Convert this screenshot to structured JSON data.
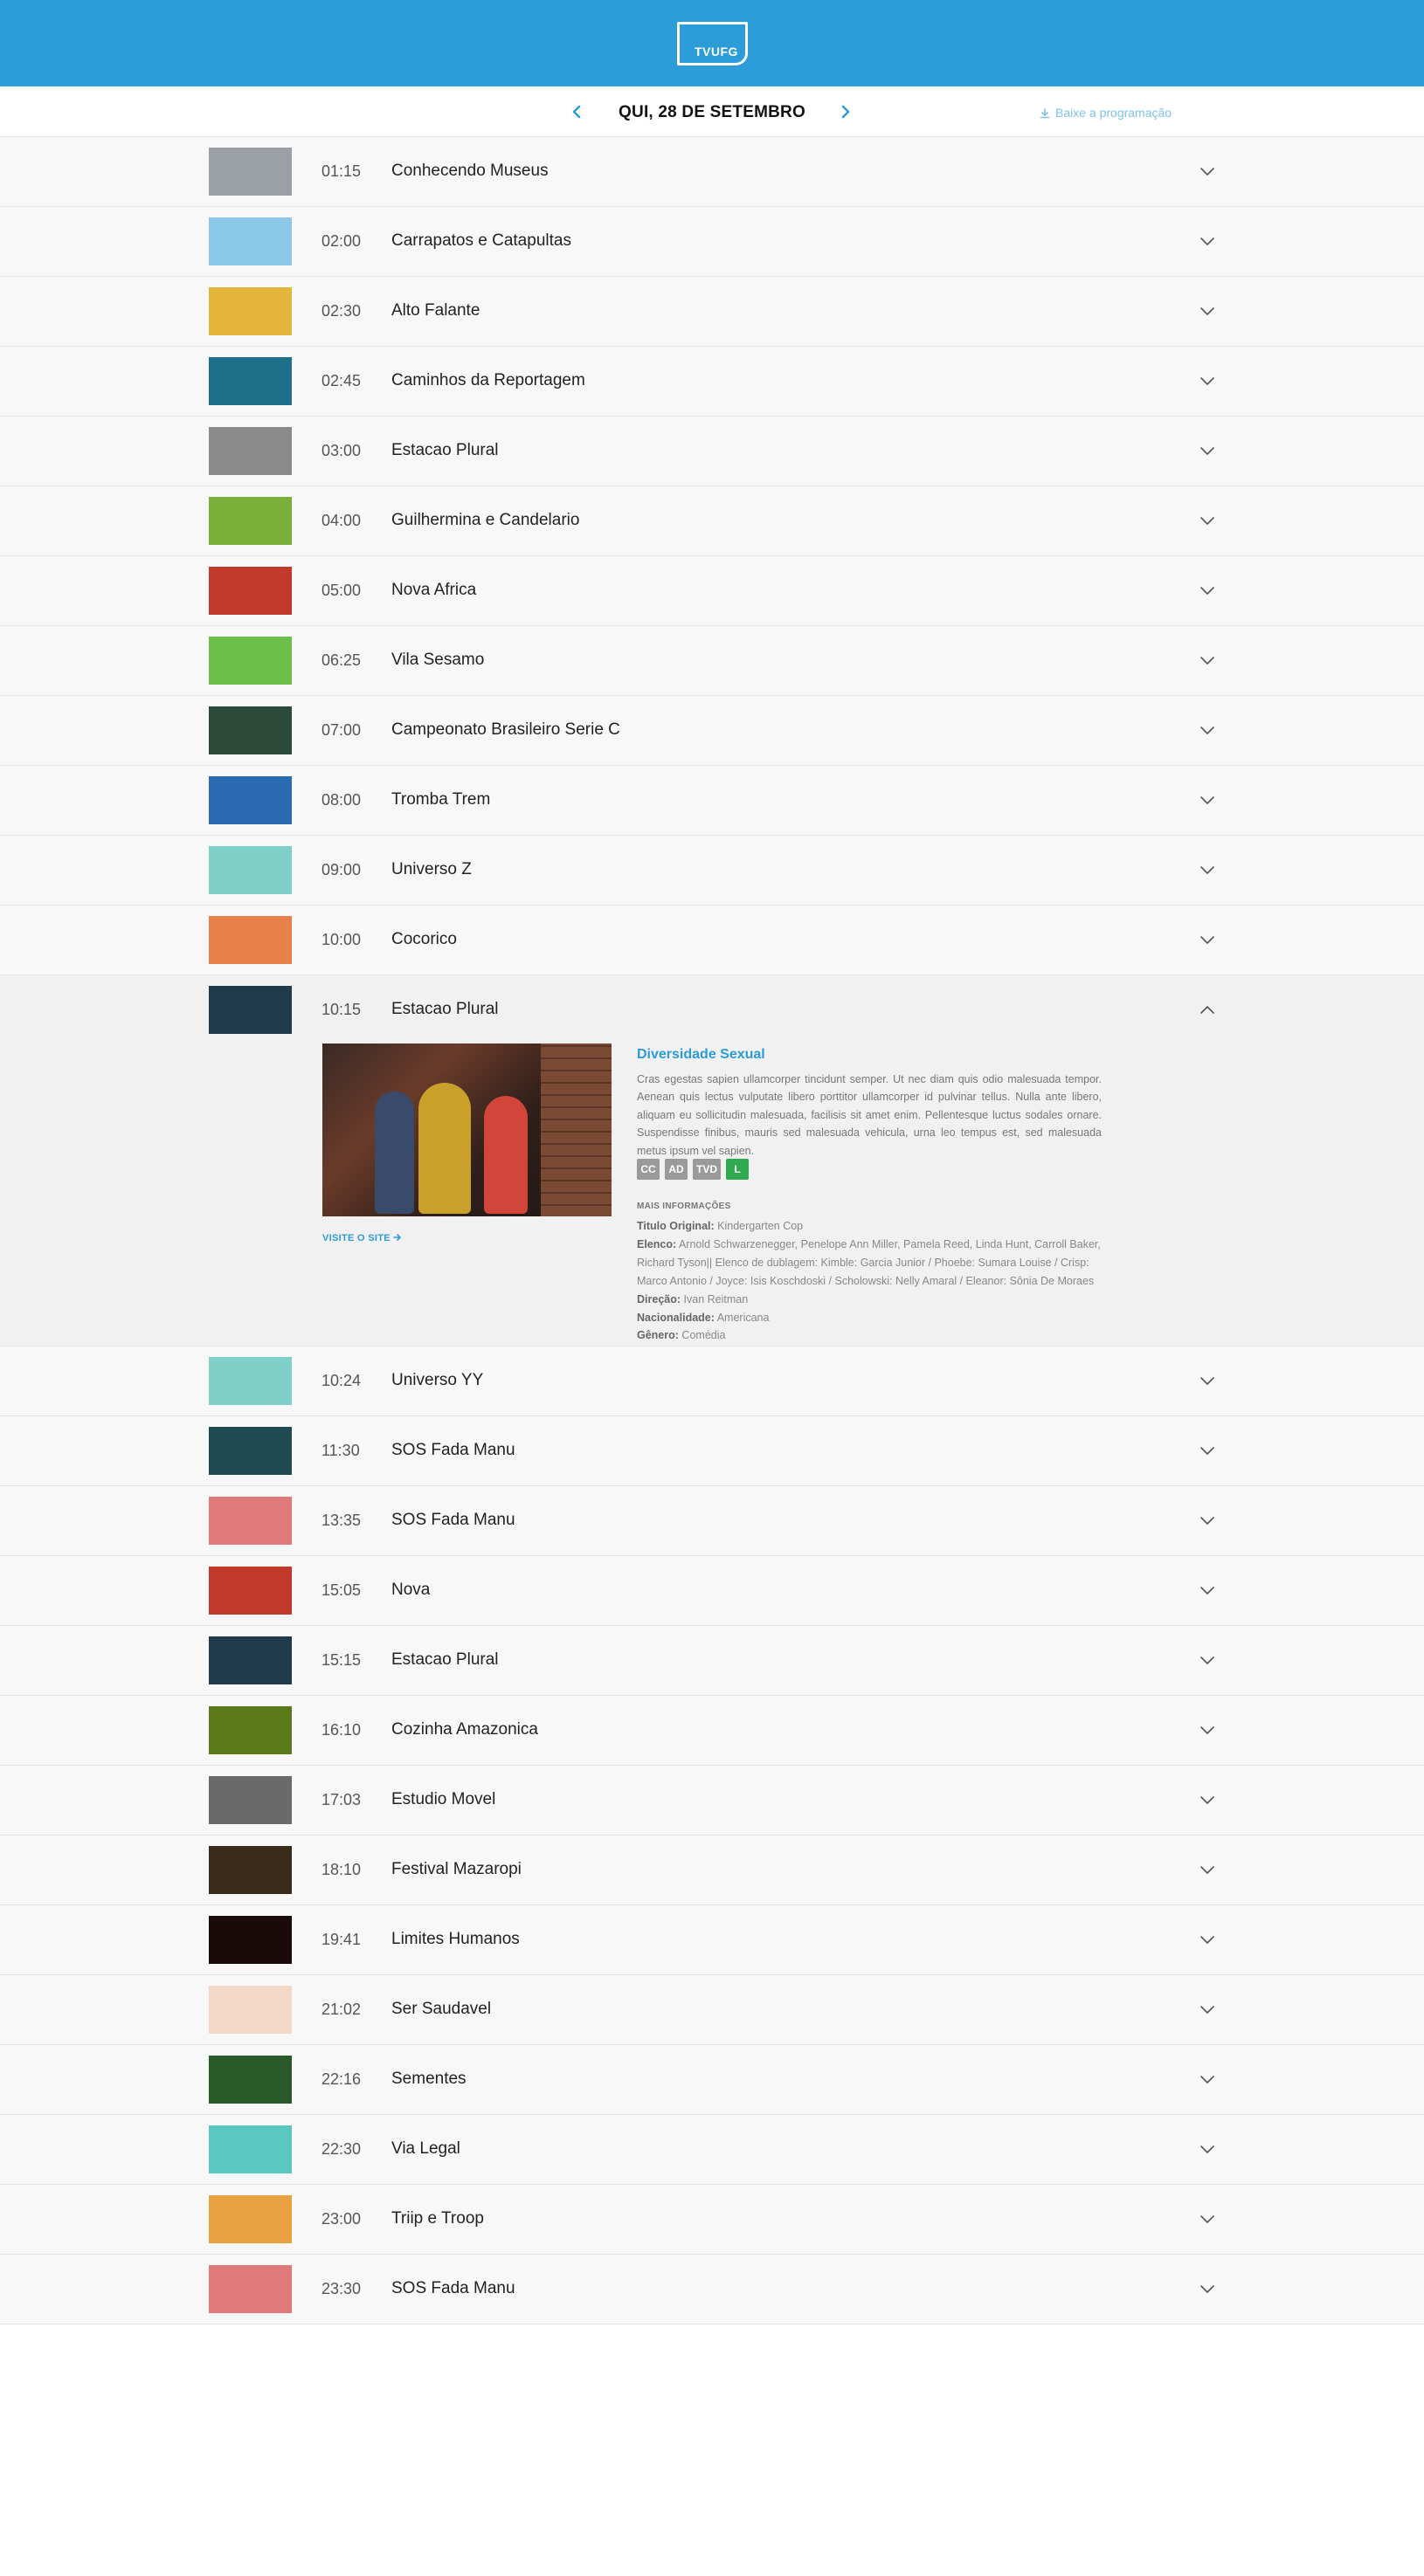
{
  "header": {
    "logo_text": "TVUFG",
    "brand_color": "#2b9cd8"
  },
  "datebar": {
    "date_label": "QUI, 28 DE SETEMBRO",
    "prev_icon": "chevron-left-icon",
    "next_icon": "chevron-right-icon",
    "download_label": "Baixe a programação",
    "download_icon": "download-icon"
  },
  "schedule": [
    {
      "time": "01:15",
      "title": "Conhecendo Museus",
      "thumb_color": "#9aa0a6"
    },
    {
      "time": "02:00",
      "title": "Carrapatos e Catapultas",
      "thumb_color": "#8cc8e8"
    },
    {
      "time": "02:30",
      "title": "Alto Falante",
      "thumb_color": "#e3b53a"
    },
    {
      "time": "02:45",
      "title": "Caminhos da Reportagem",
      "thumb_color": "#1e6f8a"
    },
    {
      "time": "03:00",
      "title": "Estacao Plural",
      "thumb_color": "#8a8a8a"
    },
    {
      "time": "04:00",
      "title": "Guilhermina e Candelario",
      "thumb_color": "#7ab03a"
    },
    {
      "time": "05:00",
      "title": "Nova Africa",
      "thumb_color": "#c0392b"
    },
    {
      "time": "06:25",
      "title": "Vila Sesamo",
      "thumb_color": "#6cc04a"
    },
    {
      "time": "07:00",
      "title": "Campeonato Brasileiro Serie C",
      "thumb_color": "#2c4a3a"
    },
    {
      "time": "08:00",
      "title": "Tromba Trem",
      "thumb_color": "#2a6ab0"
    },
    {
      "time": "09:00",
      "title": "Universo Z",
      "thumb_color": "#7fd0c8"
    },
    {
      "time": "10:00",
      "title": "Cocorico",
      "thumb_color": "#e8804a"
    }
  ],
  "expanded": {
    "time": "10:15",
    "title": "Estacao Plural",
    "thumb_color": "#1f3a4a",
    "episode_title": "Diversidade Sexual",
    "synopsis": "Cras egestas sapien ullamcorper tincidunt semper. Ut nec diam quis odio malesuada tempor. Aenean quis lectus vulputate libero porttitor ullamcorper id pulvinar tellus. Nulla ante libero, aliquam eu sollicitudin malesuada, facilisis sit amet enim. Pellentesque luctus sodales ornare. Suspendisse finibus, mauris sed malesuada vehicula, urna leo tempus est, sed malesuada metus ipsum vel sapien.",
    "badges": [
      "CC",
      "AD",
      "TVD",
      "L"
    ],
    "rating_color": "#2fa84f",
    "visit_label": "VISITE O SITE",
    "more_label": "MAIS INFORMAÇÕES",
    "info": [
      {
        "label": "Titulo Original:",
        "value": "Kindergarten Cop"
      },
      {
        "label": "Elenco:",
        "value": "Arnold Schwarzenegger, Penelope Ann Miller, Pamela Reed, Linda Hunt, Carroll Baker, Richard Tyson|| Elenco de dublagem: Kimble: Garcia Junior / Phoebe: Sumara Louise / Crisp: Marco Antonio / Joyce: Isis Koschdoski / Scholowski: Nelly Amaral / Eleanor: Sônia De Moraes"
      },
      {
        "label": "Direção:",
        "value": "Ivan Reitman"
      },
      {
        "label": "Nacionalidade:",
        "value": "Americana"
      },
      {
        "label": "Gênero:",
        "value": "Comédia"
      }
    ]
  },
  "schedule_after": [
    {
      "time": "10:24",
      "title": "Universo YY",
      "thumb_color": "#7fd0c8"
    },
    {
      "time": "11:30",
      "title": "SOS Fada Manu",
      "thumb_color": "#1f4a52"
    },
    {
      "time": "13:35",
      "title": "SOS Fada Manu",
      "thumb_color": "#e07a7a"
    },
    {
      "time": "15:05",
      "title": "Nova",
      "thumb_color": "#c0392b"
    },
    {
      "time": "15:15",
      "title": "Estacao Plural",
      "thumb_color": "#1f3a4a"
    },
    {
      "time": "16:10",
      "title": "Cozinha Amazonica",
      "thumb_color": "#5a7a1a"
    },
    {
      "time": "17:03",
      "title": "Estudio Movel",
      "thumb_color": "#6a6a6a"
    },
    {
      "time": "18:10",
      "title": "Festival Mazaropi",
      "thumb_color": "#3a2a1a"
    },
    {
      "time": "19:41",
      "title": "Limites Humanos",
      "thumb_color": "#1a0a0a"
    },
    {
      "time": "21:02",
      "title": "Ser Saudavel",
      "thumb_color": "#f3d8c8"
    },
    {
      "time": "22:16",
      "title": "Sementes",
      "thumb_color": "#2a5a2a"
    },
    {
      "time": "22:30",
      "title": "Via Legal",
      "thumb_color": "#5ac8c0"
    },
    {
      "time": "23:00",
      "title": "Triip e Troop",
      "thumb_color": "#e8a040"
    },
    {
      "time": "23:30",
      "title": "SOS Fada Manu",
      "thumb_color": "#e07a7a"
    }
  ]
}
